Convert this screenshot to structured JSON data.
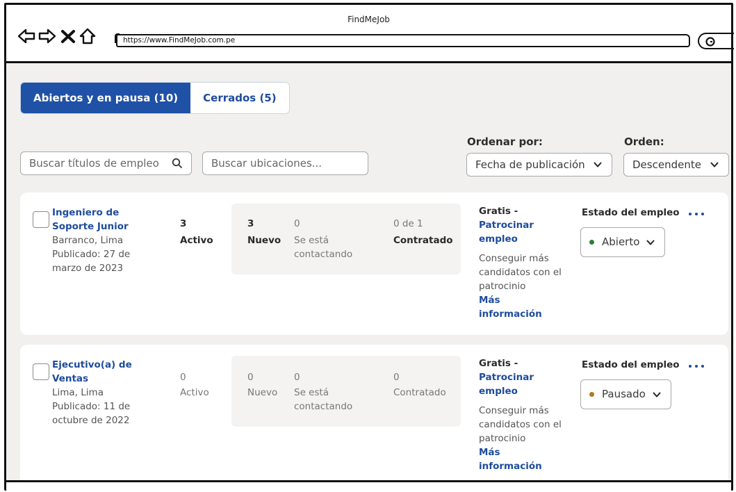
{
  "window": {
    "title": "FindMeJob"
  },
  "browser": {
    "url": "https://www.FindMeJob.com.pe"
  },
  "tabs": [
    {
      "label": "Abiertos y en pausa (10)",
      "active": true
    },
    {
      "label": "Cerrados (5)",
      "active": false
    }
  ],
  "filters": {
    "title_search_placeholder": "Buscar títulos de empleo",
    "location_search_placeholder": "Buscar ubicaciones...",
    "sort_label": "Ordenar por:",
    "sort_value": "Fecha de publicación",
    "order_label": "Orden:",
    "order_value": "Descendente"
  },
  "jobs": [
    {
      "title": "Ingeniero de Soporte Junior",
      "location": "Barranco, Lima",
      "published": "Publicado: 27 de marzo de 2023",
      "active_count": "3",
      "active_label": "Activo",
      "new_count": "3",
      "new_label": "Nuevo",
      "contacting_count": "0",
      "contacting_label": "Se está contactando",
      "hired_count": "0 de 1",
      "hired_label": "Contratado",
      "promo_head": "Gratis -",
      "promo_link": "Patrocinar empleo",
      "promo_text": "Conseguir más candidatos con el patrocinio",
      "promo_more": "Más información",
      "status_label": "Estado del empleo",
      "status_value": "Abierto",
      "status_color": "#2e7d32"
    },
    {
      "title": "Ejecutivo(a) de Ventas",
      "location": "Lima, Lima",
      "published": "Publicado: 11 de octubre de 2022",
      "active_count": "0",
      "active_label": "Activo",
      "new_count": "0",
      "new_label": "Nuevo",
      "contacting_count": "0",
      "contacting_label": "Se está contactando",
      "hired_count": "0",
      "hired_label": "Contratado",
      "promo_head": "Gratis -",
      "promo_link": "Patrocinar empleo",
      "promo_text": "Conseguir más candidatos con el patrocinio",
      "promo_more": "Más información",
      "status_label": "Estado del empleo",
      "status_value": "Pausado",
      "status_color": "#b07a1e"
    }
  ]
}
